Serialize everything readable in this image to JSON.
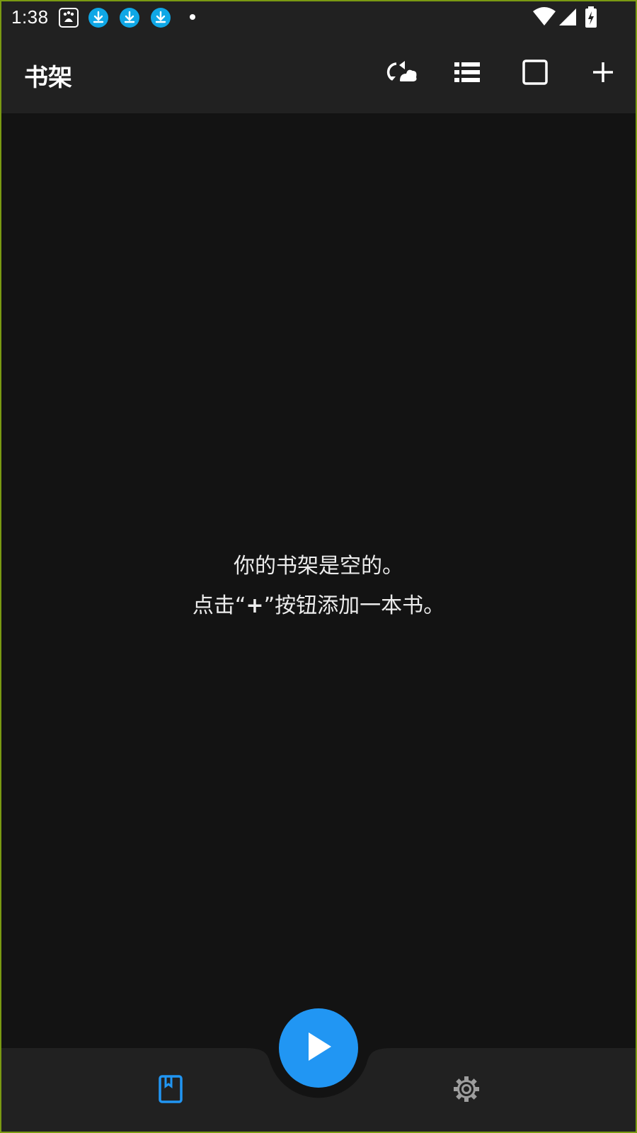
{
  "status_bar": {
    "time": "1:38",
    "icons": [
      "baidu-icon",
      "download-icon",
      "download-icon",
      "download-icon",
      "dot-icon",
      "wifi-icon",
      "cell-signal-icon",
      "battery-charging-icon"
    ],
    "download_color": "#0fa7e6"
  },
  "app_bar": {
    "title": "书架",
    "actions": [
      "sync-cloud-icon",
      "list-view-icon",
      "select-box-icon",
      "add-icon"
    ]
  },
  "empty_state": {
    "line1": "你的书架是空的。",
    "line2_prefix": "点击“",
    "line2_plus": "+",
    "line2_suffix": "”按钮添加一本书。"
  },
  "bottom_nav": {
    "items": [
      {
        "icon": "bookshelf-icon",
        "active": true
      },
      {
        "icon": "settings-icon",
        "active": false
      }
    ],
    "fab_icon": "play-icon"
  },
  "colors": {
    "background": "#131313",
    "bar": "#212121",
    "accent": "#2196f3",
    "icon_inactive": "#9e9e9e"
  }
}
